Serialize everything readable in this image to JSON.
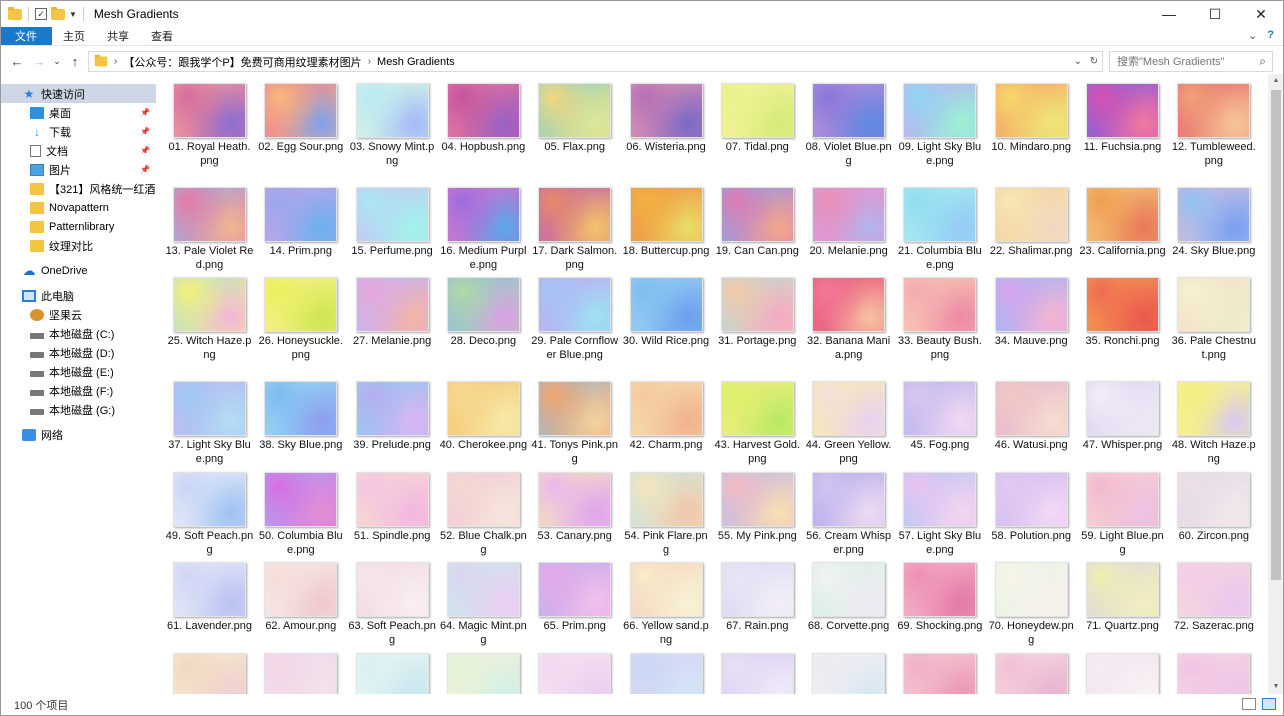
{
  "window": {
    "title": "Mesh Gradients"
  },
  "ribbon": {
    "tabs": [
      "文件",
      "主页",
      "共享",
      "查看"
    ]
  },
  "address": {
    "crumbs": [
      "【公众号：跟我学个P】免费可商用纹理素材图片",
      "Mesh Gradients"
    ]
  },
  "search": {
    "placeholder": "搜索\"Mesh Gradients\""
  },
  "nav": {
    "items": [
      {
        "label": "快速访问",
        "icon": "star-icon",
        "sel": true,
        "pin": false,
        "indent": 0
      },
      {
        "label": "桌面",
        "icon": "desktop-icon",
        "sel": false,
        "pin": true,
        "indent": 1
      },
      {
        "label": "下载",
        "icon": "download-icon",
        "sel": false,
        "pin": true,
        "indent": 1
      },
      {
        "label": "文档",
        "icon": "document-icon",
        "sel": false,
        "pin": true,
        "indent": 1
      },
      {
        "label": "图片",
        "icon": "pictures-icon",
        "sel": false,
        "pin": true,
        "indent": 1
      },
      {
        "label": "【321】风格统一红酒",
        "icon": "folder-icon",
        "sel": false,
        "pin": false,
        "indent": 1
      },
      {
        "label": "Novapattern",
        "icon": "folder-icon",
        "sel": false,
        "pin": false,
        "indent": 1
      },
      {
        "label": "Patternlibrary",
        "icon": "folder-icon",
        "sel": false,
        "pin": false,
        "indent": 1
      },
      {
        "label": "纹理对比",
        "icon": "folder-icon",
        "sel": false,
        "pin": false,
        "indent": 1
      },
      {
        "label": "",
        "icon": "",
        "sel": false,
        "pin": false,
        "indent": 0,
        "spacer": true
      },
      {
        "label": "OneDrive",
        "icon": "cloud-icon",
        "sel": false,
        "pin": false,
        "indent": 0
      },
      {
        "label": "",
        "icon": "",
        "sel": false,
        "pin": false,
        "indent": 0,
        "spacer": true
      },
      {
        "label": "此电脑",
        "icon": "computer-icon",
        "sel": false,
        "pin": false,
        "indent": 0
      },
      {
        "label": "坚果云",
        "icon": "nutstore-icon",
        "sel": false,
        "pin": false,
        "indent": 1
      },
      {
        "label": "本地磁盘 (C:)",
        "icon": "drive-icon",
        "sel": false,
        "pin": false,
        "indent": 1
      },
      {
        "label": "本地磁盘 (D:)",
        "icon": "drive-icon",
        "sel": false,
        "pin": false,
        "indent": 1
      },
      {
        "label": "本地磁盘 (E:)",
        "icon": "drive-icon",
        "sel": false,
        "pin": false,
        "indent": 1
      },
      {
        "label": "本地磁盘 (F:)",
        "icon": "drive-icon",
        "sel": false,
        "pin": false,
        "indent": 1
      },
      {
        "label": "本地磁盘 (G:)",
        "icon": "drive-icon",
        "sel": false,
        "pin": false,
        "indent": 1
      },
      {
        "label": "",
        "icon": "",
        "sel": false,
        "pin": false,
        "indent": 0,
        "spacer": true
      },
      {
        "label": "网络",
        "icon": "network-icon",
        "sel": false,
        "pin": false,
        "indent": 0
      }
    ]
  },
  "files": [
    {
      "name": "01. Royal Heath.png",
      "c": [
        "#d66c9c",
        "#f2b0a6",
        "#8b6fd1"
      ]
    },
    {
      "name": "02. Egg Sour.png",
      "c": [
        "#f7b77c",
        "#e36fa3",
        "#7fa1ee"
      ]
    },
    {
      "name": "03. Snowy Mint.png",
      "c": [
        "#b9e9f3",
        "#dff4dc",
        "#a7b9f6"
      ]
    },
    {
      "name": "04. Hopbush.png",
      "c": [
        "#c4549b",
        "#ed8bb0",
        "#9a63c7"
      ]
    },
    {
      "name": "05. Flax.png",
      "c": [
        "#f3d77f",
        "#6fd1d8",
        "#d7e79a"
      ]
    },
    {
      "name": "06. Wisteria.png",
      "c": [
        "#b36fb5",
        "#e7a4b8",
        "#7a6cc6"
      ]
    },
    {
      "name": "07. Tidal.png",
      "c": [
        "#e8f28c",
        "#f6ef9c",
        "#d5ea78"
      ]
    },
    {
      "name": "08. Violet Blue.png",
      "c": [
        "#8875d9",
        "#c5a3e3",
        "#5e8be0"
      ]
    },
    {
      "name": "09. Light Sky Blue.png",
      "c": [
        "#8fd7f1",
        "#d6a5ea",
        "#9ef0d2"
      ]
    },
    {
      "name": "10. Mindaro.png",
      "c": [
        "#f6d96a",
        "#f28f6d",
        "#efe478"
      ]
    },
    {
      "name": "11. Fuchsia.png",
      "c": [
        "#d94fb1",
        "#6273e8",
        "#f079a0"
      ]
    },
    {
      "name": "12. Tumbleweed.png",
      "c": [
        "#f0a276",
        "#e45e77",
        "#f7c59a"
      ]
    },
    {
      "name": "13. Pale Violet Red.png",
      "c": [
        "#e77aa4",
        "#8bc5f0",
        "#f0b68f"
      ]
    },
    {
      "name": "14. Prim.png",
      "c": [
        "#9aa7ee",
        "#c9a6e6",
        "#6cb1ef"
      ]
    },
    {
      "name": "15. Perfume.png",
      "c": [
        "#a9e8f4",
        "#d4b8f0",
        "#a4f0ea"
      ]
    },
    {
      "name": "16. Medium Purple.png",
      "c": [
        "#9e6ce0",
        "#e283c2",
        "#5da8e8"
      ]
    },
    {
      "name": "17. Dark Salmon.png",
      "c": [
        "#e98a65",
        "#b05fd3",
        "#f2c36c"
      ]
    },
    {
      "name": "18. Buttercup.png",
      "c": [
        "#f1b340",
        "#ee8d55",
        "#e8dc6a"
      ]
    },
    {
      "name": "19. Can Can.png",
      "c": [
        "#e07ab1",
        "#78b5f0",
        "#f2a88a"
      ]
    },
    {
      "name": "20. Melanie.png",
      "c": [
        "#e88fb7",
        "#d4a0f0",
        "#b1b5ef"
      ]
    },
    {
      "name": "21. Columbia Blue.png",
      "c": [
        "#8fdcf0",
        "#b9f0f2",
        "#97cbf6"
      ]
    },
    {
      "name": "22. Shalimar.png",
      "c": [
        "#f7e7b5",
        "#f3c79a",
        "#efd8c0"
      ]
    },
    {
      "name": "23. California.png",
      "c": [
        "#ef9f50",
        "#f6cf91",
        "#e9795c"
      ]
    },
    {
      "name": "24. Sky Blue.png",
      "c": [
        "#8fc1f3",
        "#f0b3d0",
        "#7c9ff0"
      ]
    },
    {
      "name": "25. Witch Haze.png",
      "c": [
        "#f5f079",
        "#a6d8f4",
        "#f4b6d9"
      ]
    },
    {
      "name": "26. Honeysuckle.png",
      "c": [
        "#e9ef5b",
        "#f6f2a3",
        "#cfe554"
      ]
    },
    {
      "name": "27. Melanie.png",
      "c": [
        "#e8a6da",
        "#b3c0f2",
        "#f2b6a4"
      ]
    },
    {
      "name": "28. Deco.png",
      "c": [
        "#b1d9a6",
        "#8cb1f0",
        "#d99fe6"
      ]
    },
    {
      "name": "29. Pale Cornflower Blue.png",
      "c": [
        "#a5c4f5",
        "#c7a9ef",
        "#9ee1f2"
      ]
    },
    {
      "name": "30. Wild Rice.png",
      "c": [
        "#7fbcf0",
        "#a4d5f6",
        "#6c9fee"
      ]
    },
    {
      "name": "31. Portage.png",
      "c": [
        "#f5c8a6",
        "#a9daf0",
        "#f2aac6"
      ]
    },
    {
      "name": "32. Banana Mania.png",
      "c": [
        "#f07a98",
        "#e8546e",
        "#f6c3a0"
      ]
    },
    {
      "name": "33. Beauty Bush.png",
      "c": [
        "#f4aab0",
        "#f7d3b3",
        "#ed8aa4"
      ]
    },
    {
      "name": "34. Mauve.png",
      "c": [
        "#d9a4ec",
        "#8fc4f3",
        "#f4b6d0"
      ]
    },
    {
      "name": "35. Ronchi.png",
      "c": [
        "#ef6c52",
        "#f6ad4f",
        "#ea5a4e"
      ]
    },
    {
      "name": "36. Pale Chestnut.png",
      "c": [
        "#f6f2d0",
        "#f0d6c8",
        "#eeeacc"
      ]
    },
    {
      "name": "37. Light Sky Blue.png",
      "c": [
        "#9fc9f2",
        "#d0b6f0",
        "#b5dcf4"
      ]
    },
    {
      "name": "38. Sky Blue.png",
      "c": [
        "#7fbaf2",
        "#a7e1f2",
        "#8e9ff0"
      ]
    },
    {
      "name": "39. Prelude.png",
      "c": [
        "#b6aef0",
        "#8fd7f2",
        "#d9b7f2"
      ]
    },
    {
      "name": "40. Cherokee.png",
      "c": [
        "#f7d98c",
        "#f3c57a",
        "#f6eaa8"
      ]
    },
    {
      "name": "41. Tonys Pink.png",
      "c": [
        "#f2a36b",
        "#87c6f0",
        "#f4d2a0"
      ]
    },
    {
      "name": "42. Charm.png",
      "c": [
        "#f6c9a0",
        "#f3e1b0",
        "#f0b38e"
      ]
    },
    {
      "name": "43. Harvest Gold.png",
      "c": [
        "#dcef6a",
        "#f2ea8b",
        "#b8ea64"
      ]
    },
    {
      "name": "44. Green Yellow.png",
      "c": [
        "#f4dfd8",
        "#f6eaa8",
        "#e8d2ee"
      ]
    },
    {
      "name": "45. Fog.png",
      "c": [
        "#d6c6f0",
        "#b8b1ee",
        "#f1d9f2"
      ]
    },
    {
      "name": "46. Watusi.png",
      "c": [
        "#f2c9c4",
        "#e1b5d8",
        "#f5ddd0"
      ]
    },
    {
      "name": "47. Whisper.png",
      "c": [
        "#f2eef6",
        "#d6c8ee",
        "#ebe5f4"
      ]
    },
    {
      "name": "48. Witch Haze.png",
      "c": [
        "#f3ee82",
        "#f6f2a2",
        "#d9c9f2"
      ]
    },
    {
      "name": "49. Soft Peach.png",
      "c": [
        "#c5d6f6",
        "#f2f3f7",
        "#9fc3f2"
      ]
    },
    {
      "name": "50. Columbia Blue.png",
      "c": [
        "#d76de2",
        "#a6b9f2",
        "#e38fd6"
      ]
    },
    {
      "name": "51. Spindle.png",
      "c": [
        "#f5c4e4",
        "#f6e2c4",
        "#f2b8de"
      ]
    },
    {
      "name": "52. Blue Chalk.png",
      "c": [
        "#f3d9d0",
        "#f0c9e2",
        "#f6e6dc"
      ]
    },
    {
      "name": "53. Canary.png",
      "c": [
        "#ebb6ef",
        "#f6f2a2",
        "#e0a6ec"
      ]
    },
    {
      "name": "54. Pink Flare.png",
      "c": [
        "#f5e6bc",
        "#b9dcea",
        "#f0c6a8"
      ]
    },
    {
      "name": "55. My Pink.png",
      "c": [
        "#f5b9c4",
        "#a8c9f2",
        "#f6e0b2"
      ]
    },
    {
      "name": "56. Cream Whisper.png",
      "c": [
        "#d2c4f0",
        "#b0a6ec",
        "#eddaf2"
      ]
    },
    {
      "name": "57. Light Sky Blue.png",
      "c": [
        "#eac2f2",
        "#a8cff5",
        "#f2d6f0"
      ]
    },
    {
      "name": "58. Polution.png",
      "c": [
        "#e4c8f2",
        "#c9bff0",
        "#f2d9f4"
      ]
    },
    {
      "name": "59. Light Blue.png",
      "c": [
        "#f2b8d0",
        "#f7dfd6",
        "#eec2e2"
      ]
    },
    {
      "name": "60. Zircon.png",
      "c": [
        "#ecdfe6",
        "#e2dbe6",
        "#f2e8ec"
      ]
    },
    {
      "name": "61. Lavender.png",
      "c": [
        "#cfd6f6",
        "#eef0f8",
        "#b9c2f2"
      ]
    },
    {
      "name": "62. Amour.png",
      "c": [
        "#f7dcd8",
        "#f2ecf0",
        "#f0c8cc"
      ]
    },
    {
      "name": "63. Soft Peach.png",
      "c": [
        "#f5e6e8",
        "#f0d8e0",
        "#f8eef0"
      ]
    },
    {
      "name": "64. Magic Mint.png",
      "c": [
        "#dcd4f2",
        "#c8f0e6",
        "#eacff2"
      ]
    },
    {
      "name": "65. Prim.png",
      "c": [
        "#e7a8e8",
        "#b3b8f0",
        "#f0c0ec"
      ]
    },
    {
      "name": "66. Yellow sand.png",
      "c": [
        "#f7ecc8",
        "#f5c8c0",
        "#f7f1d6"
      ]
    },
    {
      "name": "67. Rain.png",
      "c": [
        "#eae6f4",
        "#d9d2f2",
        "#f2eef8"
      ]
    },
    {
      "name": "68. Corvette.png",
      "c": [
        "#f2f2f4",
        "#c8eed8",
        "#ede9f2"
      ]
    },
    {
      "name": "69. Shocking.png",
      "c": [
        "#ee8fb4",
        "#f5c2d4",
        "#e57aa8"
      ]
    },
    {
      "name": "70. Honeydew.png",
      "c": [
        "#f7f4e8",
        "#dff2e6",
        "#f5f0ec"
      ]
    },
    {
      "name": "71. Quartz.png",
      "c": [
        "#eef0b0",
        "#d8cdf2",
        "#f2ecc4"
      ]
    },
    {
      "name": "72. Sazerac.png",
      "c": [
        "#f2cce8",
        "#f6dcd8",
        "#e8c8ee"
      ]
    },
    {
      "name": "",
      "c": [
        "#f2d8c0",
        "#f6eedc",
        "#f0d0d0"
      ]
    },
    {
      "name": "",
      "c": [
        "#f4d6e6",
        "#ebe0f2",
        "#f2e2ea"
      ]
    },
    {
      "name": "",
      "c": [
        "#d8f0f2",
        "#eef6f0",
        "#c8e6f0"
      ]
    },
    {
      "name": "",
      "c": [
        "#e4f2d8",
        "#f4efe0",
        "#d2f0e6"
      ]
    },
    {
      "name": "",
      "c": [
        "#f2d8f0",
        "#f6e6ee",
        "#ead0f0"
      ]
    },
    {
      "name": "",
      "c": [
        "#c8d8f4",
        "#e4d8f4",
        "#d6e6f6"
      ]
    },
    {
      "name": "",
      "c": [
        "#e8e0f6",
        "#d9c8f2",
        "#f0eaf8"
      ]
    },
    {
      "name": "",
      "c": [
        "#e9ecf2",
        "#f4f0f4",
        "#d8e8f2"
      ]
    },
    {
      "name": "",
      "c": [
        "#f0b0c4",
        "#f6d2d6",
        "#ec98b4"
      ]
    },
    {
      "name": "",
      "c": [
        "#f2c0d4",
        "#f6e0e6",
        "#e8b4d0"
      ]
    },
    {
      "name": "",
      "c": [
        "#f6ecf2",
        "#f2e0f0",
        "#f8f2f4"
      ]
    },
    {
      "name": "",
      "c": [
        "#f2c2e2",
        "#f6e2e8",
        "#eec6e6"
      ]
    }
  ],
  "status": {
    "count": "100 个项目"
  }
}
